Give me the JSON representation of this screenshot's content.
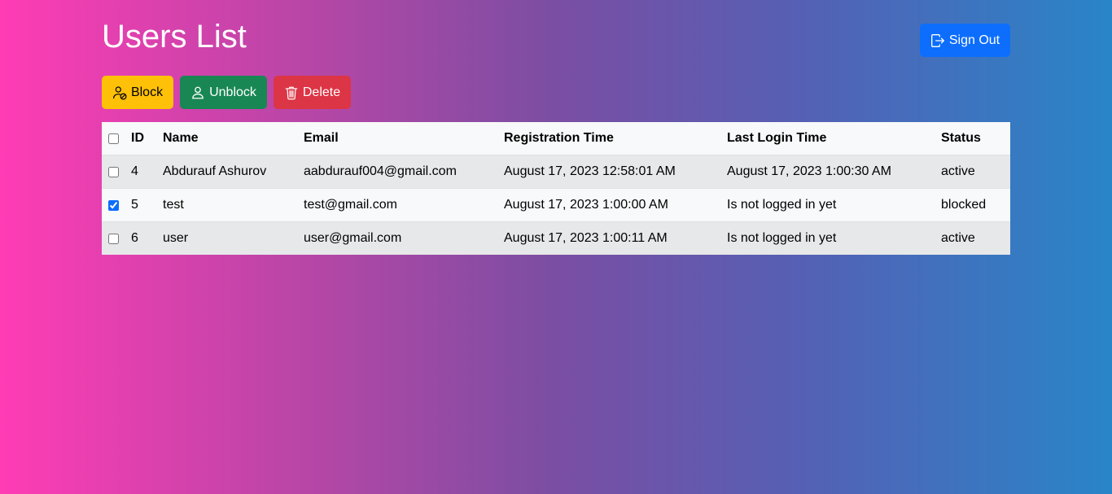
{
  "page": {
    "title": "Users List"
  },
  "header": {
    "signout_label": "Sign Out"
  },
  "toolbar": {
    "block_label": "Block",
    "unblock_label": "Unblock",
    "delete_label": "Delete"
  },
  "table": {
    "headers": {
      "id": "ID",
      "name": "Name",
      "email": "Email",
      "registration": "Registration Time",
      "last_login": "Last Login Time",
      "status": "Status"
    },
    "select_all_checked": false,
    "rows": [
      {
        "checked": false,
        "id": "4",
        "name": "Abdurauf Ashurov",
        "email": "aabdurauf004@gmail.com",
        "registration": "August 17, 2023 12:58:01 AM",
        "last_login": "August 17, 2023 1:00:30 AM",
        "status": "active"
      },
      {
        "checked": true,
        "id": "5",
        "name": "test",
        "email": "test@gmail.com",
        "registration": "August 17, 2023 1:00:00 AM",
        "last_login": "Is not logged in yet",
        "status": "blocked"
      },
      {
        "checked": false,
        "id": "6",
        "name": "user",
        "email": "user@gmail.com",
        "registration": "August 17, 2023 1:00:11 AM",
        "last_login": "Is not logged in yet",
        "status": "active"
      }
    ]
  },
  "colors": {
    "gradient_start": "#ff3cb4",
    "gradient_end": "#2985c8",
    "signout_button": "#0d6efd",
    "block_button": "#ffc107",
    "unblock_button": "#198754",
    "delete_button": "#dc3545"
  },
  "icons": {
    "signout": "box-arrow-right-icon",
    "block": "person-slash-icon",
    "unblock": "person-icon",
    "delete": "trash-icon"
  }
}
